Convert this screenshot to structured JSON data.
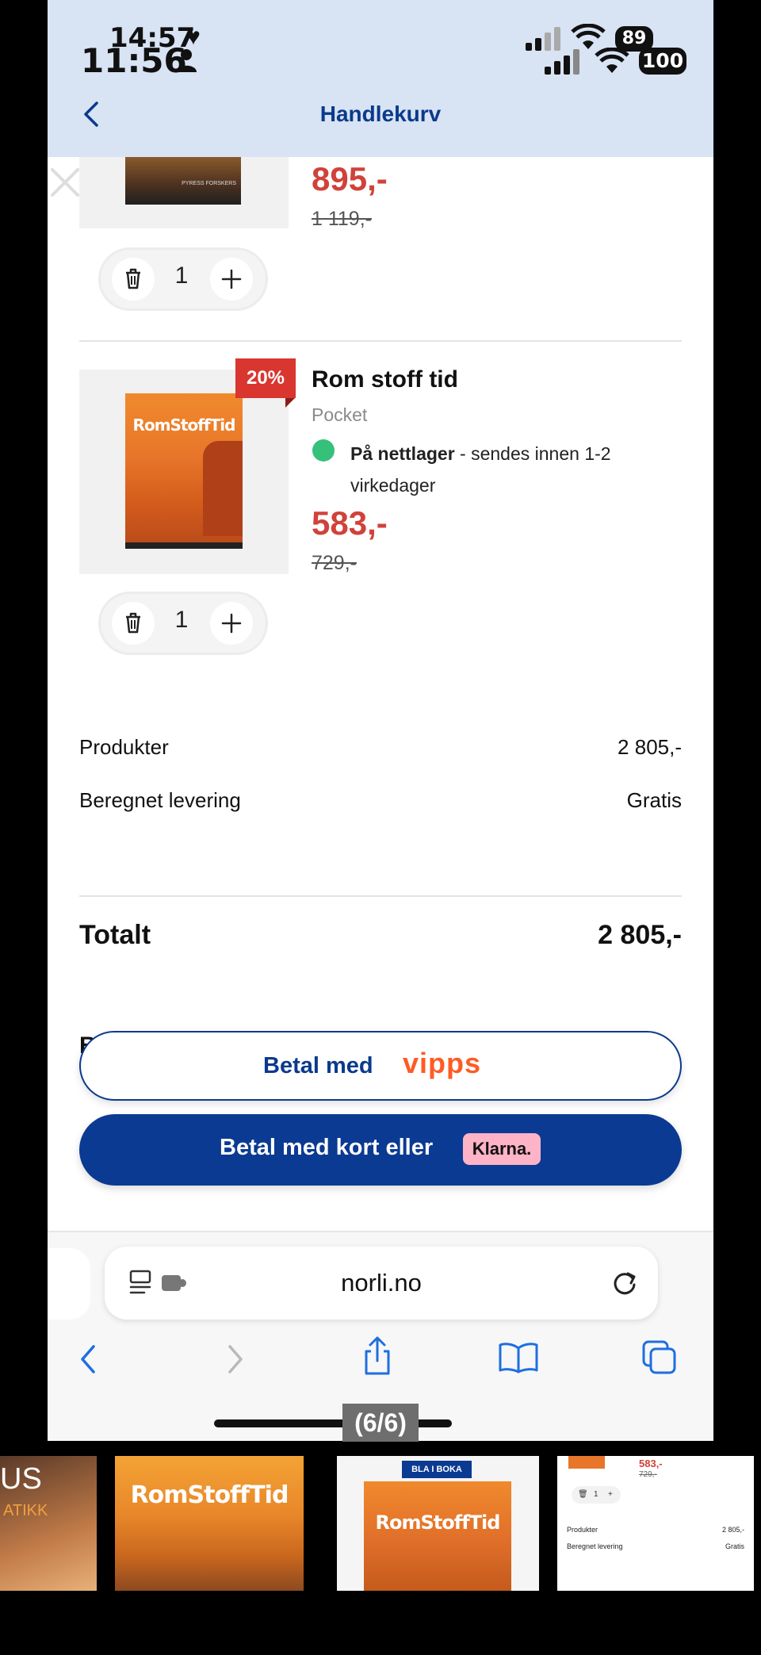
{
  "status_bar": {
    "time_front": "14:57",
    "time_back": "11:56",
    "battery_front": "89",
    "battery_back": "100"
  },
  "header": {
    "title": "Handlekurv"
  },
  "cart": {
    "items": [
      {
        "price": "895,-",
        "old_price": "1 119,-",
        "quantity": "1",
        "cover_title": "PYRESS FORSKERS"
      },
      {
        "discount_badge": "20%",
        "title": "Rom stoff tid",
        "format": "Pocket",
        "stock_status": "På nettlager",
        "stock_note": " - sendes innen 1-2 virkedager",
        "price": "583,-",
        "old_price": "729,-",
        "quantity": "1",
        "cover_title": "RomStoffTid"
      }
    ]
  },
  "summary": {
    "products_label": "Produkter",
    "products_value": "2 805,-",
    "delivery_label": "Beregnet levering",
    "delivery_value": "Gratis",
    "total_label": "Totalt",
    "total_value": "2 805,-",
    "hidden_heading": "B"
  },
  "payment": {
    "vipps_label": "Betal med",
    "vipps_brand": "vipps",
    "card_label": "Betal med kort eller",
    "klarna_brand": "Klarna."
  },
  "browser": {
    "url": "norli.no"
  },
  "viewer": {
    "counter": "(6/6)"
  },
  "thumbnails": {
    "first_text": "US",
    "first_subtext": "ATIKK",
    "second_title": "RomStoffTid",
    "third_badge": "BLA I BOKA",
    "third_title": "RomStoffTid",
    "fourth_price": "583,-",
    "fourth_old_price": "729,-",
    "fourth_qty": "1",
    "fourth_products_label": "Produkter",
    "fourth_products_value": "2 805,-",
    "fourth_delivery_label": "Beregnet levering",
    "fourth_delivery_value": "Gratis"
  },
  "colors": {
    "header_bg": "#d8e3f3",
    "brand_blue": "#0b3a92",
    "price_red": "#d0423a",
    "discount_red": "#d8362f",
    "stock_green": "#35c17a",
    "vipps_orange": "#ff5b24",
    "klarna_pink": "#ffb3c7"
  },
  "icons": [
    "back-chevron-icon",
    "close-icon",
    "trash-icon",
    "plus-icon",
    "reader-icon",
    "extension-icon",
    "reload-icon",
    "forward-icon",
    "share-icon",
    "bookmarks-icon",
    "tabs-icon"
  ]
}
